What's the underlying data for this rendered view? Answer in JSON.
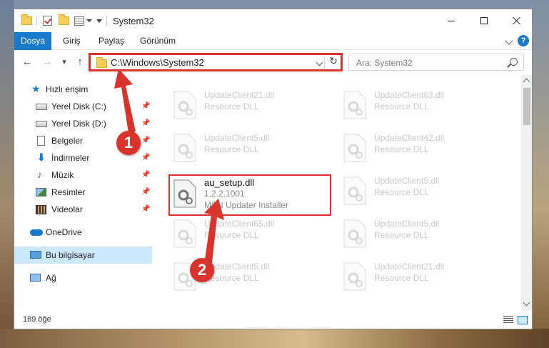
{
  "window": {
    "title": "System32"
  },
  "ribbon": {
    "tabs": [
      "Dosya",
      "Giriş",
      "Paylaş",
      "Görünüm"
    ],
    "help": "?"
  },
  "nav": {
    "back": "←",
    "forward": "→",
    "recent": "▾",
    "up": "↑",
    "address": "C:\\Windows\\System32",
    "refresh": "↻",
    "search_placeholder": "Ara: System32"
  },
  "sidebar": {
    "quick_access": "Hızlı erişim",
    "items": [
      {
        "label": "Yerel Disk (C:)",
        "icon": "drive-icon"
      },
      {
        "label": "Yerel Disk (D:)",
        "icon": "drive-icon"
      },
      {
        "label": "Belgeler",
        "icon": "documents-icon"
      },
      {
        "label": "İndirmeler",
        "icon": "downloads-icon"
      },
      {
        "label": "Müzik",
        "icon": "music-icon"
      },
      {
        "label": "Resimler",
        "icon": "pictures-icon"
      },
      {
        "label": "Videolar",
        "icon": "videos-icon"
      }
    ],
    "onedrive": "OneDrive",
    "this_pc": "Bu bilgisayar",
    "network": "Ağ"
  },
  "files": {
    "left": [
      {
        "name": "UpdateClient21.dll",
        "desc": "Resource DLL"
      },
      {
        "name": "UpdateClient5.dll",
        "desc": "Resource DLL"
      },
      {
        "name": "UpdateClient65.dll",
        "desc": "Resource DLL"
      },
      {
        "name": "UpdateClient5.dll",
        "desc": "Resource DLL"
      }
    ],
    "right": [
      {
        "name": "UpdateClient63.dll",
        "desc": "Resource DLL"
      },
      {
        "name": "UpdateClient42.dll",
        "desc": "Resource DLL"
      },
      {
        "name": "UpdateClient5.dll",
        "desc": "Resource DLL"
      },
      {
        "name": "UpdateClient5.dll",
        "desc": "Resource DLL"
      },
      {
        "name": "UpdateClient21.dll",
        "desc": "Resource DLL"
      }
    ],
    "highlighted": {
      "name": "au_setup.dll",
      "version": "1.2.2.1001",
      "desc": "MSN Updater Installer"
    }
  },
  "status": {
    "count": "189 öğe"
  },
  "annotations": {
    "step1": "1",
    "step2": "2",
    "color": "#d9342b"
  }
}
